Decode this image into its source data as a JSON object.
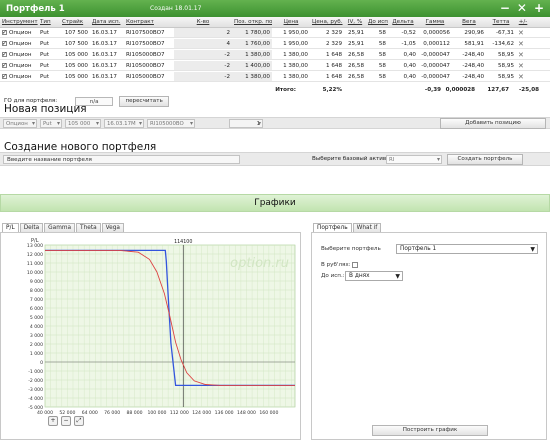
{
  "portfolio": {
    "title": "Портфель 1",
    "created": "Создан 18.01.17",
    "actions": [
      "−",
      "✕",
      "+"
    ]
  },
  "table": {
    "headers": [
      "Инструмент",
      "Тип",
      "Страйк",
      "Дата исп.",
      "Контракт",
      "К-во",
      "Поз. откр. по",
      "Цена",
      "Цена, руб.",
      "IV, %",
      "До исп.",
      "Дельта",
      "Гамма",
      "Вега",
      "Тетта",
      "+/-"
    ],
    "rows": [
      [
        "Опцион",
        "Put",
        "107 500",
        "16.03.17",
        "RI107500BO7",
        "2",
        "1 780,00",
        "1 950,00",
        "2 329",
        "25,91",
        "58",
        "-0,52",
        "0,000056",
        "290,96",
        "-67,31"
      ],
      [
        "Опцион",
        "Put",
        "107 500",
        "16.03.17",
        "RI107500BO7",
        "4",
        "1 760,00",
        "1 950,00",
        "2 329",
        "25,91",
        "58",
        "-1,05",
        "0,000112",
        "581,91",
        "-134,62"
      ],
      [
        "Опцион",
        "Put",
        "105 000",
        "16.03.17",
        "RI105000BO7",
        "-2",
        "1 380,00",
        "1 380,00",
        "1 648",
        "26,58",
        "58",
        "0,40",
        "-0,000047",
        "-248,40",
        "58,95"
      ],
      [
        "Опцион",
        "Put",
        "105 000",
        "16.03.17",
        "RI105000BO7",
        "-2",
        "1 400,00",
        "1 380,00",
        "1 648",
        "26,58",
        "58",
        "0,40",
        "-0,000047",
        "-248,40",
        "58,95"
      ],
      [
        "Опцион",
        "Put",
        "105 000",
        "16.03.17",
        "RI105000BO7",
        "-2",
        "1 380,00",
        "1 380,00",
        "1 648",
        "26,58",
        "58",
        "0,40",
        "-0,000047",
        "-248,40",
        "58,95"
      ]
    ],
    "totals": {
      "label": "Итого:",
      "pnl_pct": "5,22%",
      "delta": "-0,39",
      "gamma": "0,000028",
      "vega": "127,67",
      "theta": "-25,08"
    }
  },
  "go": {
    "label": "ГО для портфеля:",
    "value": "n/a",
    "recalc_button": "пересчитать"
  },
  "new_position": {
    "heading": "Новая позиция",
    "instrument": "Опцион",
    "type": "Put",
    "strike": "105 000",
    "date": "16.03.17M",
    "contract": "RI105000BO",
    "quantity": "1",
    "add_button": "Добавить позицию"
  },
  "create_portfolio": {
    "heading": "Создание нового портфеля",
    "name_placeholder": "Введите название портфеля",
    "base_asset_label": "Выберите базовый актив",
    "base_asset_value": "RI",
    "create_button": "Создать портфель"
  },
  "charts": {
    "heading": "Графики",
    "tabs": [
      "P/L",
      "Delta",
      "Gamma",
      "Theta",
      "Vega"
    ],
    "active_tab": "P/L",
    "watermark": "option.ru",
    "y_axis_label": "P/L",
    "marker_label": "114100",
    "zoom": [
      "+",
      "−",
      "⤢"
    ]
  },
  "right_panel": {
    "tabs": [
      "Портфель",
      "What if"
    ],
    "active_tab": "Портфель",
    "portfolio_label": "Выберите портфель",
    "portfolio_value": "Портфель 1",
    "rub_label": "В руб'лях:",
    "days_label": "До исп.:",
    "days_value": "В днях",
    "build_button": "Построить график"
  },
  "colors": {
    "header_green": "#4ea43d",
    "chart_bg": "#eef7e6",
    "grid": "#cfe5c0",
    "expiry_line": "#3355dd",
    "current_line": "#dd4444"
  },
  "chart_data": {
    "type": "line",
    "title": "",
    "ylabel": "P/L",
    "xlabel": "",
    "xlim": [
      40000,
      174000
    ],
    "ylim": [
      -5000,
      13000
    ],
    "x_ticks": [
      40000,
      52000,
      64000,
      76000,
      88000,
      100000,
      112000,
      124000,
      136000,
      148000,
      160000
    ],
    "y_ticks": [
      13000,
      12000,
      11000,
      10000,
      9000,
      8000,
      7000,
      6000,
      5000,
      4000,
      3000,
      2000,
      1000,
      0,
      -1000,
      -2000,
      -3000,
      -4000,
      -5000
    ],
    "vertical_marker": 114100,
    "grid": true,
    "series": [
      {
        "color": "#3355dd",
        "x": [
          40000,
          102000,
          104500,
          105000,
          106000,
          107500,
          110000,
          174000
        ],
        "y": [
          12400,
          12400,
          12400,
          11200,
          7500,
          2100,
          -2600,
          -2600
        ]
      },
      {
        "color": "#dd4444",
        "x": [
          40000,
          80000,
          90000,
          96000,
          100000,
          104000,
          107000,
          110000,
          113000,
          116000,
          120000,
          126000,
          134000,
          150000,
          174000
        ],
        "y": [
          12400,
          12400,
          12200,
          11400,
          10000,
          7600,
          5000,
          2200,
          200,
          -1200,
          -2100,
          -2500,
          -2600,
          -2600,
          -2600
        ]
      }
    ]
  }
}
